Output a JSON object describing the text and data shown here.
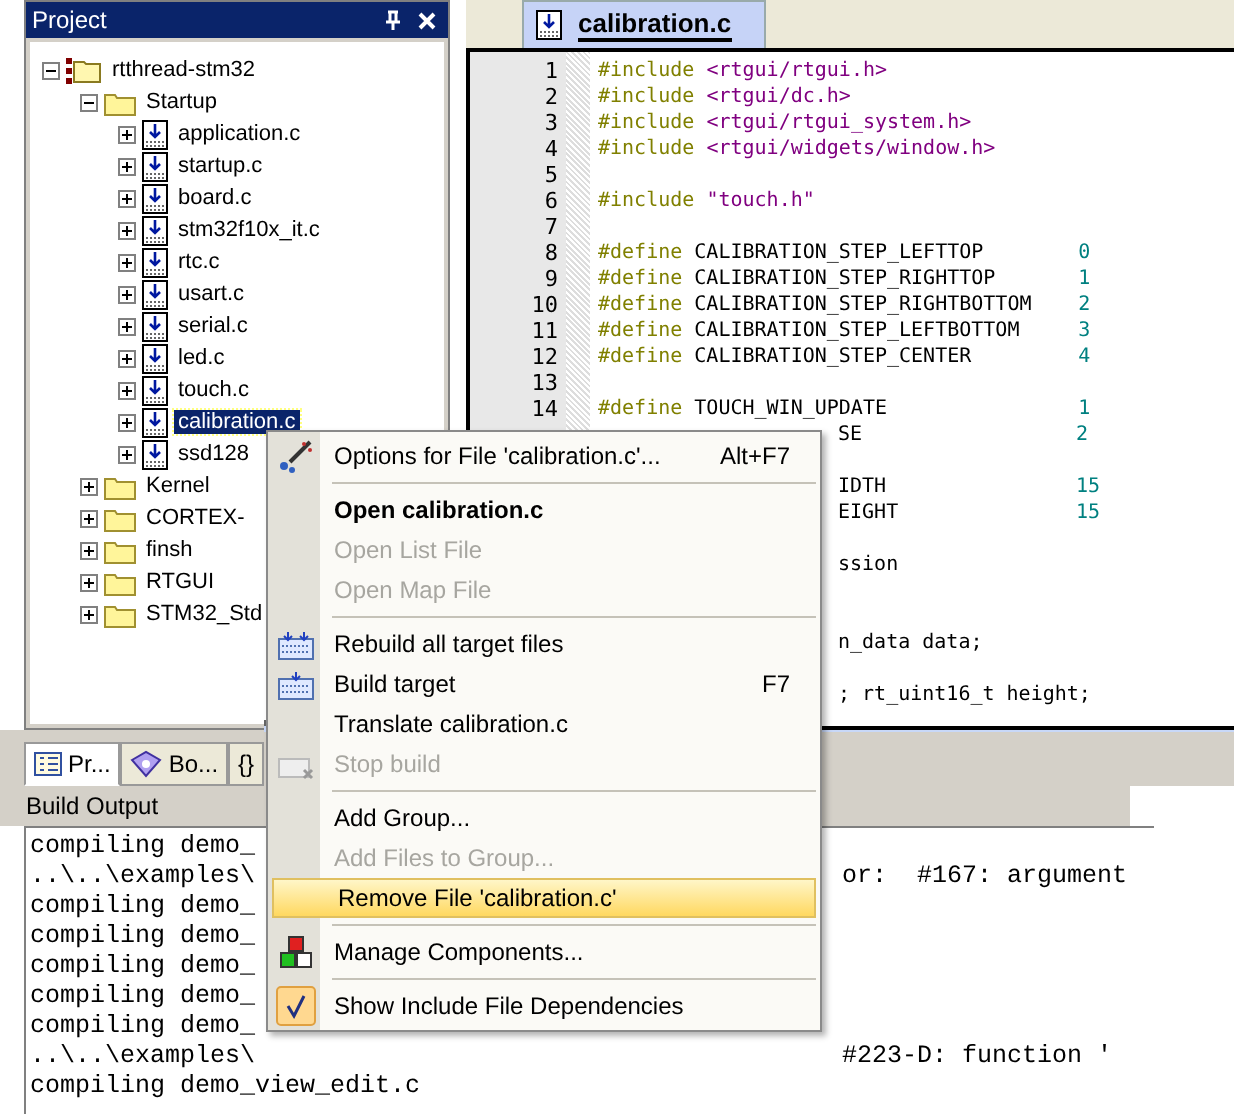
{
  "project_panel": {
    "title": "Project",
    "tree": [
      {
        "label": "rtthread-stm32",
        "kind": "project",
        "expanded": true,
        "children": [
          {
            "label": "Startup",
            "kind": "folder",
            "expanded": true,
            "children": [
              {
                "label": "application.c",
                "kind": "file",
                "expanded": false,
                "selected": false
              },
              {
                "label": "startup.c",
                "kind": "file",
                "expanded": false,
                "selected": false
              },
              {
                "label": "board.c",
                "kind": "file",
                "expanded": false,
                "selected": false
              },
              {
                "label": "stm32f10x_it.c",
                "kind": "file",
                "expanded": false,
                "selected": false
              },
              {
                "label": "rtc.c",
                "kind": "file",
                "expanded": false,
                "selected": false
              },
              {
                "label": "usart.c",
                "kind": "file",
                "expanded": false,
                "selected": false
              },
              {
                "label": "serial.c",
                "kind": "file",
                "expanded": false,
                "selected": false
              },
              {
                "label": "led.c",
                "kind": "file",
                "expanded": false,
                "selected": false
              },
              {
                "label": "touch.c",
                "kind": "file",
                "expanded": false,
                "selected": false
              },
              {
                "label": "calibration.c",
                "kind": "file",
                "expanded": false,
                "selected": true
              },
              {
                "label": "ssd128",
                "kind": "file",
                "expanded": false,
                "selected": false
              }
            ]
          },
          {
            "label": "Kernel",
            "kind": "folder",
            "expanded": false
          },
          {
            "label": "CORTEX-",
            "kind": "folder",
            "expanded": false
          },
          {
            "label": "finsh",
            "kind": "folder",
            "expanded": false
          },
          {
            "label": "RTGUI",
            "kind": "folder",
            "expanded": false
          },
          {
            "label": "STM32_Std",
            "kind": "folder",
            "expanded": false
          }
        ]
      }
    ],
    "tabs": [
      {
        "label": "Pr...",
        "kind": "project",
        "selected": true
      },
      {
        "label": "Bo...",
        "kind": "books",
        "selected": false
      },
      {
        "label": "{}",
        "kind": "functions",
        "selected": false
      }
    ]
  },
  "editor": {
    "tab": "calibration.c",
    "lines": [
      {
        "num": "1",
        "segs": [
          {
            "kind": "directive",
            "text": "#include"
          },
          {
            "kind": "string",
            "text": " <rtgui/rtgui.h>"
          }
        ]
      },
      {
        "num": "2",
        "segs": [
          {
            "kind": "directive",
            "text": "#include"
          },
          {
            "kind": "string",
            "text": " <rtgui/dc.h>"
          }
        ]
      },
      {
        "num": "3",
        "segs": [
          {
            "kind": "directive",
            "text": "#include"
          },
          {
            "kind": "string",
            "text": " <rtgui/rtgui_system.h>"
          }
        ]
      },
      {
        "num": "4",
        "segs": [
          {
            "kind": "directive",
            "text": "#include"
          },
          {
            "kind": "string",
            "text": " <rtgui/widgets/window.h>"
          }
        ]
      },
      {
        "num": "5"
      },
      {
        "num": "6",
        "segs": [
          {
            "kind": "directive",
            "text": "#include"
          },
          {
            "kind": "string",
            "text": " \"touch.h\""
          }
        ]
      },
      {
        "num": "7"
      },
      {
        "num": "8",
        "segs": [
          {
            "kind": "directive",
            "text": "#define"
          },
          {
            "kind": "name",
            "text": "CALIBRATION_STEP_LEFTTOP"
          },
          {
            "kind": "number",
            "text": "0"
          }
        ]
      },
      {
        "num": "9",
        "segs": [
          {
            "kind": "directive",
            "text": "#define"
          },
          {
            "kind": "name",
            "text": "CALIBRATION_STEP_RIGHTTOP"
          },
          {
            "kind": "number",
            "text": "1"
          }
        ]
      },
      {
        "num": "10",
        "segs": [
          {
            "kind": "directive",
            "text": "#define"
          },
          {
            "kind": "name",
            "text": "CALIBRATION_STEP_RIGHTBOTTOM"
          },
          {
            "kind": "number",
            "text": "2"
          }
        ]
      },
      {
        "num": "11",
        "segs": [
          {
            "kind": "directive",
            "text": "#define"
          },
          {
            "kind": "name",
            "text": "CALIBRATION_STEP_LEFTBOTTOM"
          },
          {
            "kind": "number",
            "text": "3"
          }
        ]
      },
      {
        "num": "12",
        "segs": [
          {
            "kind": "directive",
            "text": "#define"
          },
          {
            "kind": "name",
            "text": "CALIBRATION_STEP_CENTER"
          },
          {
            "kind": "number",
            "text": "4"
          }
        ]
      },
      {
        "num": "13"
      },
      {
        "num": "14",
        "segs": [
          {
            "kind": "directive",
            "text": "#define"
          },
          {
            "kind": "name",
            "text": "TOUCH_WIN_UPDATE"
          },
          {
            "kind": "number",
            "text": "1"
          }
        ]
      },
      {
        "tail": true,
        "segs": [
          {
            "kind": "name",
            "text": "SE"
          },
          {
            "kind": "number",
            "text": "2"
          }
        ]
      },
      {
        "tail": true
      },
      {
        "tail": true,
        "segs": [
          {
            "kind": "name",
            "text": "IDTH"
          },
          {
            "kind": "number",
            "text": "15"
          }
        ]
      },
      {
        "tail": true,
        "segs": [
          {
            "kind": "name",
            "text": "EIGHT"
          },
          {
            "kind": "number",
            "text": "15"
          }
        ]
      },
      {
        "tail": true
      },
      {
        "tail": true,
        "segs": [
          {
            "kind": "plain",
            "text": "ssion"
          }
        ]
      },
      {
        "tail": true
      },
      {
        "tail": true
      },
      {
        "tail": true,
        "segs": [
          {
            "kind": "plain",
            "text": "n_data data;"
          }
        ]
      },
      {
        "tail": true
      },
      {
        "tail": true,
        "segs": [
          {
            "kind": "plain",
            "text": "; rt_uint16_t height;"
          }
        ]
      }
    ]
  },
  "build_output": {
    "title": "Build Output",
    "lines": [
      {
        "left": "compiling demo_"
      },
      {
        "left": "..\\..\\examples\\",
        "right": "or:  #167: argument"
      },
      {
        "left": "compiling demo_"
      },
      {
        "left": "compiling demo_"
      },
      {
        "left": "compiling demo_"
      },
      {
        "left": "compiling demo_"
      },
      {
        "left": "compiling demo_"
      },
      {
        "left": "..\\..\\examples\\",
        "right": "#223-D: function '"
      },
      {
        "left": "compiling demo_view_edit.c"
      }
    ]
  },
  "context_menu": {
    "items": [
      {
        "kind": "item",
        "label": "Options for File 'calibration.c'...",
        "shortcut": "Alt+F7",
        "disabled": false,
        "bold": false,
        "selected": false
      },
      {
        "kind": "separator"
      },
      {
        "kind": "item",
        "label": "Open calibration.c",
        "disabled": false,
        "bold": true,
        "selected": false
      },
      {
        "kind": "item",
        "label": "Open List File",
        "disabled": true,
        "bold": false,
        "selected": false
      },
      {
        "kind": "item",
        "label": "Open Map File",
        "disabled": true,
        "bold": false,
        "selected": false
      },
      {
        "kind": "separator"
      },
      {
        "kind": "item",
        "label": "Rebuild all target files",
        "disabled": false,
        "bold": false,
        "selected": false
      },
      {
        "kind": "item",
        "label": "Build target",
        "shortcut": "F7",
        "disabled": false,
        "bold": false,
        "selected": false
      },
      {
        "kind": "item",
        "label": "Translate calibration.c",
        "disabled": false,
        "bold": false,
        "selected": false
      },
      {
        "kind": "item",
        "label": "Stop build",
        "disabled": true,
        "bold": false,
        "selected": false
      },
      {
        "kind": "separator"
      },
      {
        "kind": "item",
        "label": "Add Group...",
        "disabled": false,
        "bold": false,
        "selected": false
      },
      {
        "kind": "item",
        "label": "Add Files to Group...",
        "disabled": true,
        "bold": false,
        "selected": false
      },
      {
        "kind": "item",
        "label": "Remove File 'calibration.c'",
        "disabled": false,
        "bold": false,
        "selected": true
      },
      {
        "kind": "separator"
      },
      {
        "kind": "item",
        "label": "Manage Components...",
        "disabled": false,
        "bold": false,
        "selected": false
      },
      {
        "kind": "separator"
      },
      {
        "kind": "item",
        "label": "Show Include File Dependencies",
        "disabled": false,
        "bold": false,
        "selected": false,
        "checked": true
      }
    ]
  }
}
